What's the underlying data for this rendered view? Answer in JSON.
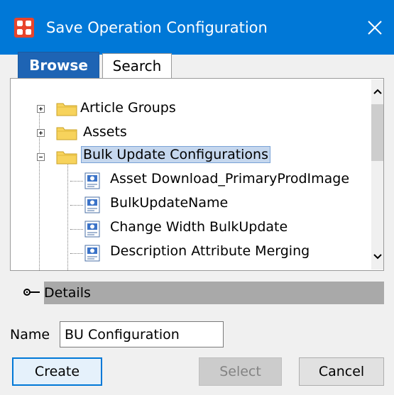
{
  "window": {
    "title": "Save Operation Configuration",
    "icon": "app-logo-icon",
    "close_icon": "close-icon",
    "accent": "#0078d7"
  },
  "tabs": [
    {
      "label": "Browse",
      "active": true
    },
    {
      "label": "Search",
      "active": false
    }
  ],
  "tree": {
    "items": [
      {
        "label": "Article Groups",
        "type": "folder",
        "expanded": false
      },
      {
        "label": "Assets",
        "type": "folder",
        "expanded": false
      },
      {
        "label": "Bulk Update Configurations",
        "type": "folder",
        "expanded": true,
        "selected": true
      },
      {
        "label": "Asset Download_PrimaryProdImage",
        "type": "configuration"
      },
      {
        "label": "BulkUpdateName",
        "type": "configuration"
      },
      {
        "label": "Change Width BulkUpdate",
        "type": "configuration"
      },
      {
        "label": "Description Attribute Merging",
        "type": "configuration"
      }
    ]
  },
  "details": {
    "label": "Details"
  },
  "name": {
    "label": "Name",
    "value": "BU Configuration"
  },
  "buttons": {
    "create": "Create",
    "select": "Select",
    "cancel": "Cancel"
  }
}
